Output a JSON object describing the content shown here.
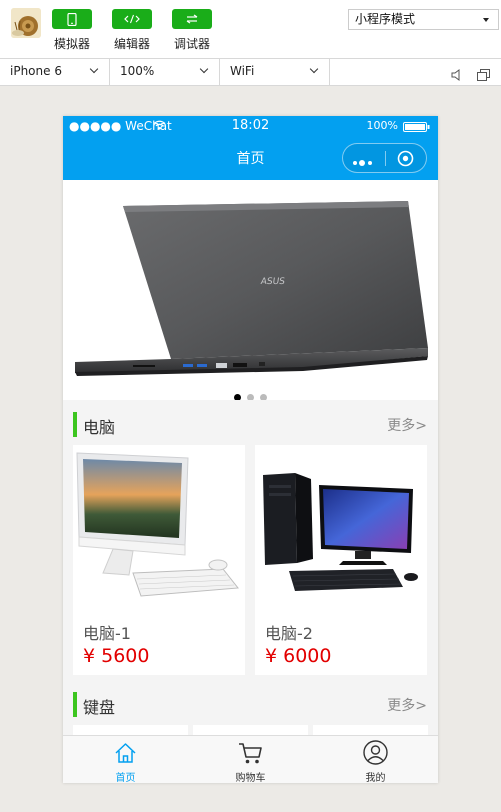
{
  "toolbar": {
    "simulator_label": "模拟器",
    "editor_label": "编辑器",
    "debugger_label": "调试器",
    "mode_value": "小程序模式",
    "accent_color": "#1aad19"
  },
  "devbar": {
    "device": "iPhone 6",
    "zoom": "100%",
    "network": "WiFi"
  },
  "status": {
    "carrier": "●●●●● WeChat",
    "time": "18:02",
    "battery": "100%"
  },
  "navbar": {
    "title": "首页",
    "color": "#03a0f0"
  },
  "banner": {
    "slide_count": 3,
    "active_index": 0
  },
  "sections": [
    {
      "title": "电脑",
      "more": "更多>",
      "products": [
        {
          "name": "电脑-1",
          "price": "¥ 5600"
        },
        {
          "name": "电脑-2",
          "price": "¥ 6000"
        }
      ]
    },
    {
      "title": "键盘",
      "more": "更多>"
    }
  ],
  "tabbar": {
    "items": [
      {
        "label": "首页",
        "icon": "home-icon"
      },
      {
        "label": "购物车",
        "icon": "cart-icon"
      },
      {
        "label": "我的",
        "icon": "user-icon"
      }
    ],
    "active_color": "#03a0f0"
  }
}
